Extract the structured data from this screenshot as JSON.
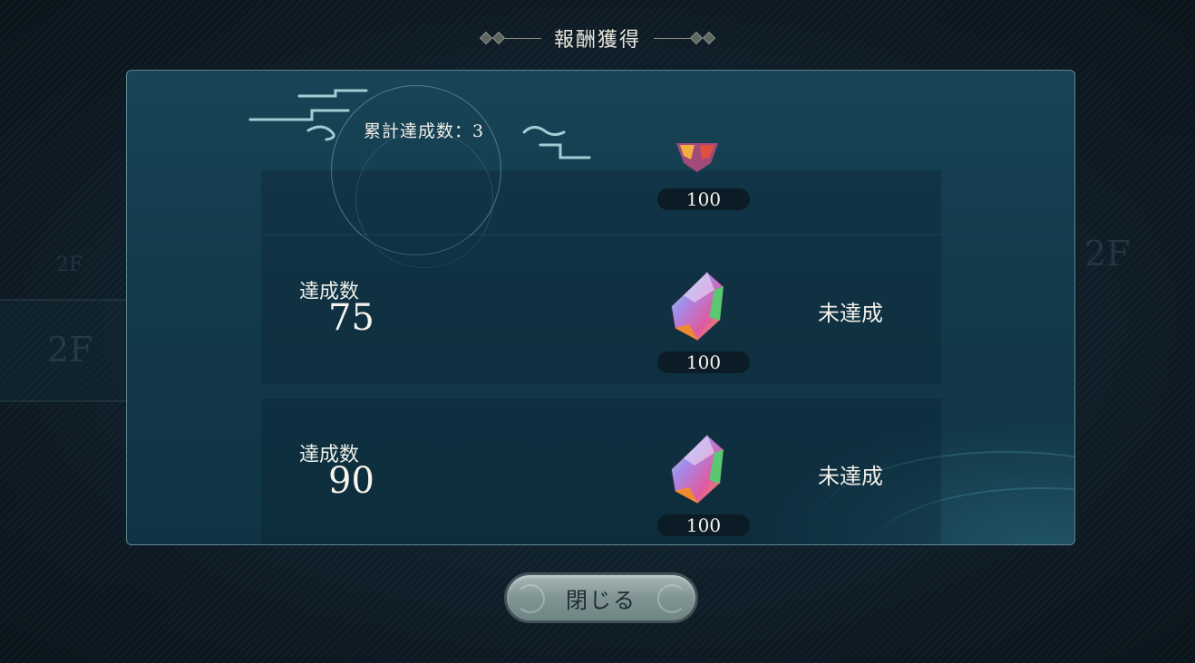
{
  "header": {
    "title": "報酬獲得"
  },
  "panel": {
    "cumulative_label": "累計達成数：3",
    "partial_row": {
      "quantity": "100"
    },
    "rows": [
      {
        "label": "達成数",
        "count": "75",
        "quantity": "100",
        "status": "未達成"
      },
      {
        "label": "達成数",
        "count": "90",
        "quantity": "100",
        "status": "未達成"
      }
    ]
  },
  "background": {
    "floor_label_a": "2F",
    "floor_label_b": "2F",
    "floor_label_c": "2F"
  },
  "footer": {
    "close_label": "閉じる"
  },
  "colors": {
    "panel": "#133a4b",
    "accent": "#a8b8b6",
    "text": "#f3f1ea"
  },
  "icons": {
    "reward": "rainbow-gem-icon",
    "ornament": "diamond-ornament-icon",
    "cloud": "cloud-ornament-icon"
  }
}
